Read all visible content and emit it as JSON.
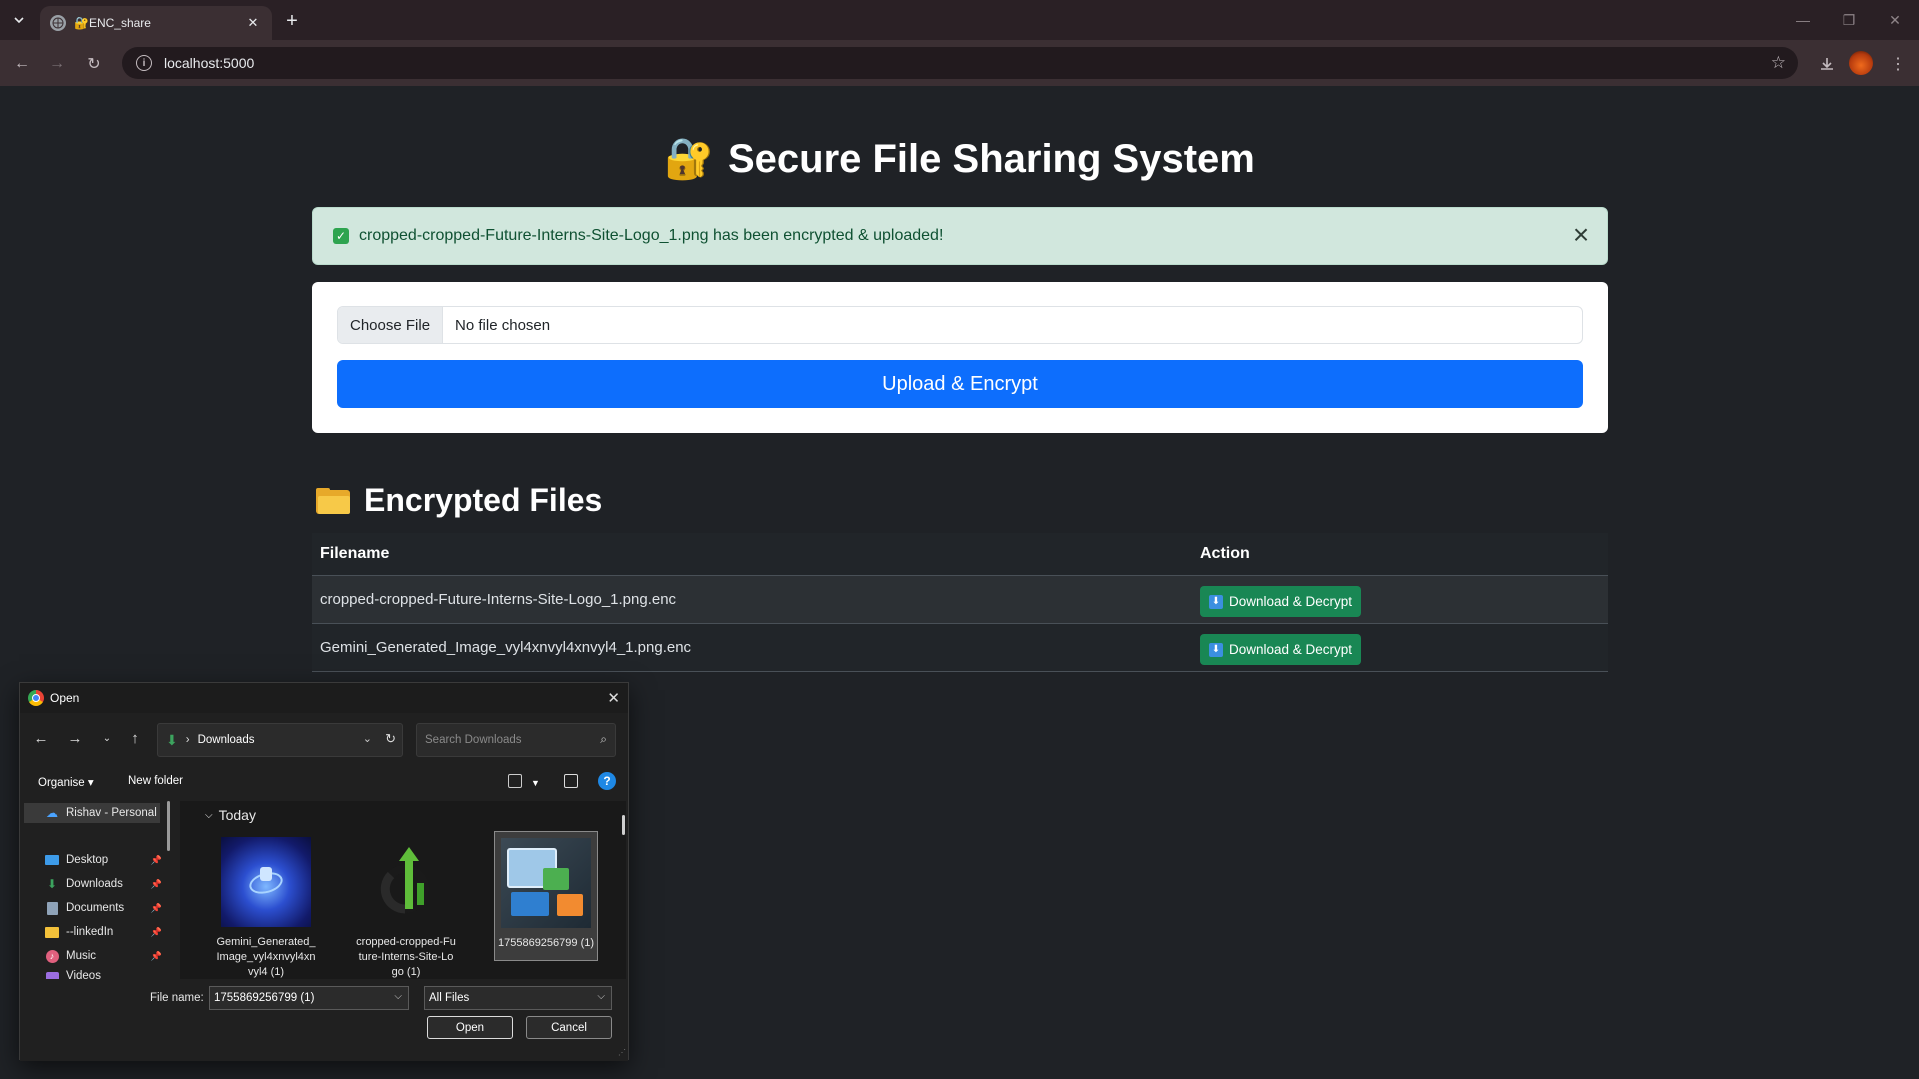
{
  "browser": {
    "tab_title": "🔐ENC_share",
    "url": "localhost:5000"
  },
  "page": {
    "title": "Secure File Sharing System",
    "title_emoji": "🔐",
    "alert": {
      "check": "✓",
      "message": "cropped-cropped-Future-Interns-Site-Logo_1.png has been encrypted & uploaded!",
      "close": "×"
    },
    "upload": {
      "choose_label": "Choose File",
      "no_file": "No file chosen",
      "submit_label": "Upload & Encrypt"
    },
    "files": {
      "heading": "Encrypted Files",
      "columns": [
        "Filename",
        "Action"
      ],
      "rows": [
        {
          "filename": "cropped-cropped-Future-Interns-Site-Logo_1.png.enc",
          "action": "Download & Decrypt"
        },
        {
          "filename": "Gemini_Generated_Image_vyl4xnvyl4xnvyl4_1.png.enc",
          "action": "Download & Decrypt"
        }
      ]
    }
  },
  "dialog": {
    "title": "Open",
    "address": "Downloads",
    "search_placeholder": "Search Downloads",
    "commands": {
      "organise": "Organise ▾",
      "new_folder": "New folder"
    },
    "sidebar": [
      {
        "label": "Rishav - Personal",
        "icon": "onedrive-icon"
      },
      {
        "label": "Desktop",
        "icon": "desktop-icon"
      },
      {
        "label": "Downloads",
        "icon": "downloads-icon"
      },
      {
        "label": "Documents",
        "icon": "documents-icon"
      },
      {
        "label": "--linkedIn",
        "icon": "folder-icon"
      },
      {
        "label": "Music",
        "icon": "music-icon"
      },
      {
        "label": "Videos",
        "icon": "videos-icon"
      }
    ],
    "group": "Today",
    "items": [
      {
        "name": "Gemini_Generated_Image_vyl4xnvyl4xnvyl4 (1)"
      },
      {
        "name": "cropped-cropped-Future-Interns-Site-Logo (1)"
      },
      {
        "name": "1755869256799 (1)"
      }
    ],
    "file_name_label": "File name:",
    "file_name_value": "1755869256799 (1)",
    "file_type": "All Files",
    "open_label": "Open",
    "cancel_label": "Cancel"
  },
  "colors": {
    "accent_blue": "#0d6efd",
    "success_green": "#198754",
    "alert_bg": "#d1e7dd"
  }
}
